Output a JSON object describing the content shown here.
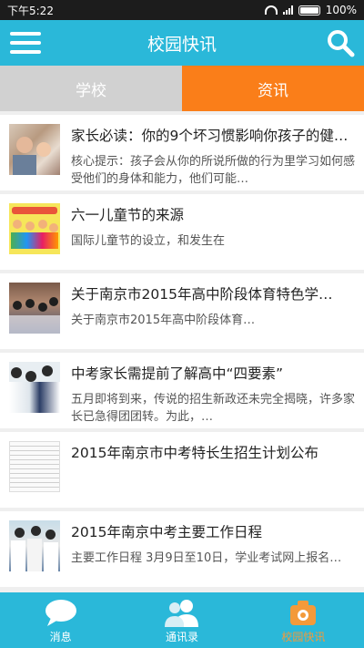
{
  "status": {
    "time": "下午5:22",
    "battery": "100%"
  },
  "header": {
    "title": "校园快讯"
  },
  "tabs": [
    {
      "label": "学校"
    },
    {
      "label": "资讯"
    }
  ],
  "news": [
    {
      "title": "家长必读：你的9个坏习惯影响你孩子的健…",
      "desc": "核心提示：孩子会从你的所说所做的行为里学习如何感受他们的身体和能力，他们可能…"
    },
    {
      "title": "六一儿童节的来源",
      "desc": "国际儿童节的设立，和发生在"
    },
    {
      "title": "关于南京市2015年高中阶段体育特色学…",
      "desc": " 关于南京市2015年高中阶段体育…"
    },
    {
      "title": "中考家长需提前了解高中“四要素”",
      "desc": "五月即将到来，传说的招生新政还未完全揭晓，许多家长已急得团团转。为此，…"
    },
    {
      "title": "2015年南京市中考特长生招生计划公布",
      "desc": ""
    },
    {
      "title": "2015年南京中考主要工作日程",
      "desc": "主要工作日程    3月9日至10日，学业考试网上报名…"
    }
  ],
  "bottom_nav": [
    {
      "label": "消息"
    },
    {
      "label": "通讯录"
    },
    {
      "label": "校园快讯"
    }
  ]
}
